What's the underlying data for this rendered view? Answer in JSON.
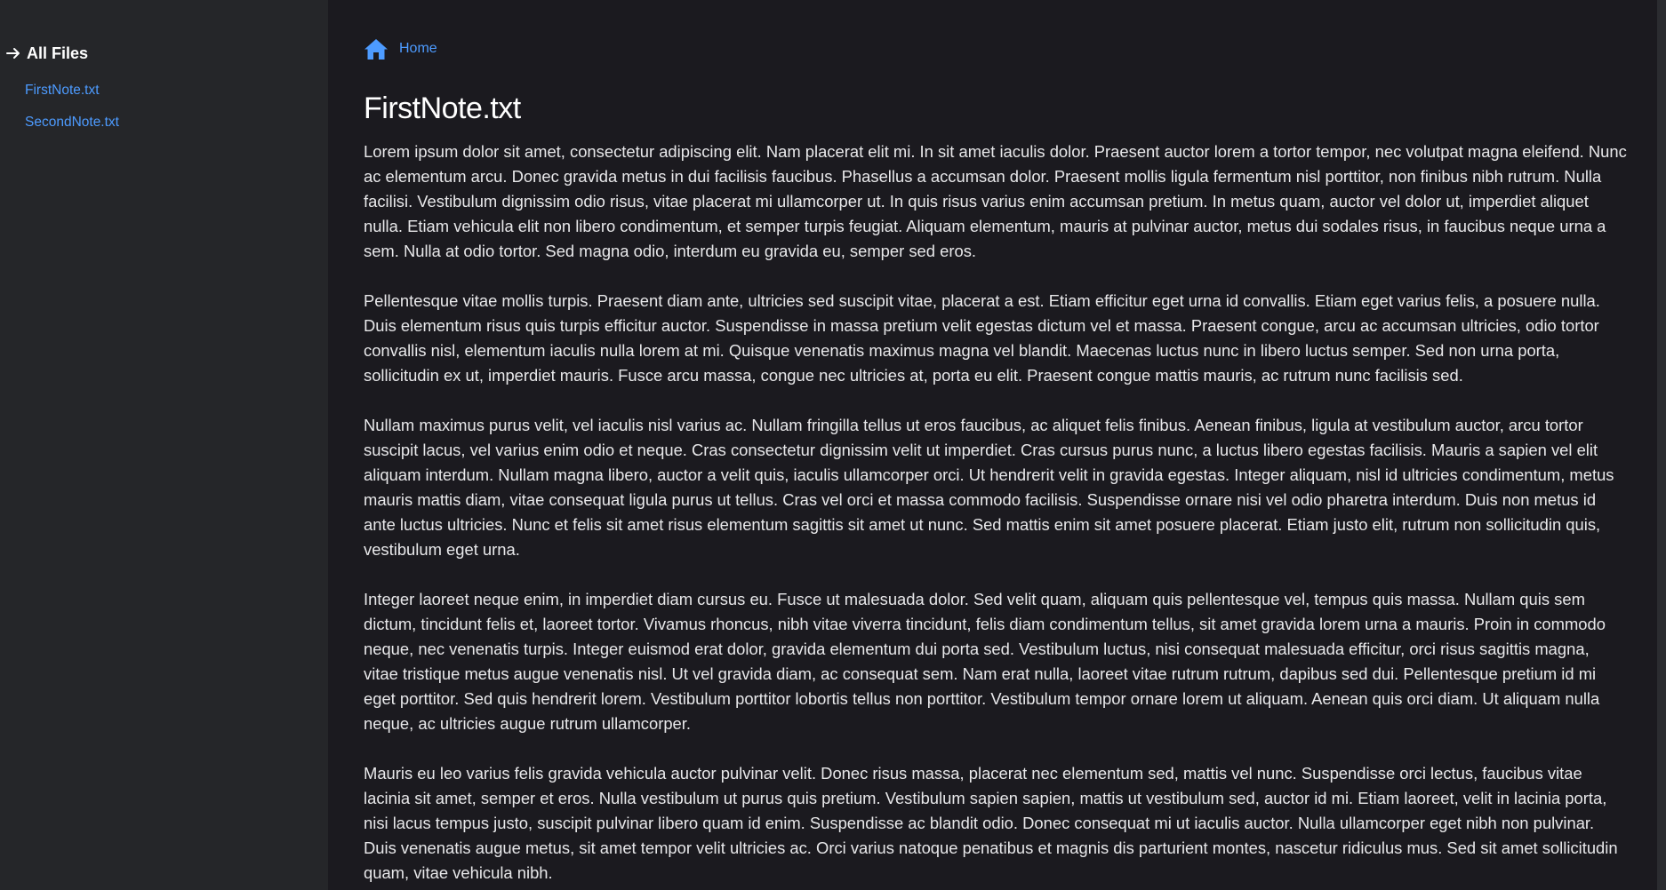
{
  "sidebar": {
    "header": "All Files",
    "files": [
      {
        "label": "FirstNote.txt"
      },
      {
        "label": "SecondNote.txt"
      }
    ]
  },
  "breadcrumb": {
    "home_label": "Home"
  },
  "note": {
    "title": "FirstNote.txt",
    "paragraphs": [
      "Lorem ipsum dolor sit amet, consectetur adipiscing elit. Nam placerat elit mi. In sit amet iaculis dolor. Praesent auctor lorem a tortor tempor, nec volutpat magna eleifend. Nunc ac elementum arcu. Donec gravida metus in dui facilisis faucibus. Phasellus a accumsan dolor. Praesent mollis ligula fermentum nisl porttitor, non finibus nibh rutrum. Nulla facilisi. Vestibulum dignissim odio risus, vitae placerat mi ullamcorper ut. In quis risus varius enim accumsan pretium. In metus quam, auctor vel dolor ut, imperdiet aliquet nulla. Etiam vehicula elit non libero condimentum, et semper turpis feugiat. Aliquam elementum, mauris at pulvinar auctor, metus dui sodales risus, in faucibus neque urna a sem. Nulla at odio tortor. Sed magna odio, interdum eu gravida eu, semper sed eros.",
      "Pellentesque vitae mollis turpis. Praesent diam ante, ultricies sed suscipit vitae, placerat a est. Etiam efficitur eget urna id convallis. Etiam eget varius felis, a posuere nulla. Duis elementum risus quis turpis efficitur auctor. Suspendisse in massa pretium velit egestas dictum vel et massa. Praesent congue, arcu ac accumsan ultricies, odio tortor convallis nisl, elementum iaculis nulla lorem at mi. Quisque venenatis maximus magna vel blandit. Maecenas luctus nunc in libero luctus semper. Sed non urna porta, sollicitudin ex ut, imperdiet mauris. Fusce arcu massa, congue nec ultricies at, porta eu elit. Praesent congue mattis mauris, ac rutrum nunc facilisis sed.",
      "Nullam maximus purus velit, vel iaculis nisl varius ac. Nullam fringilla tellus ut eros faucibus, ac aliquet felis finibus. Aenean finibus, ligula at vestibulum auctor, arcu tortor suscipit lacus, vel varius enim odio et neque. Cras consectetur dignissim velit ut imperdiet. Cras cursus purus nunc, a luctus libero egestas facilisis. Mauris a sapien vel elit aliquam interdum. Nullam magna libero, auctor a velit quis, iaculis ullamcorper orci. Ut hendrerit velit in gravida egestas. Integer aliquam, nisl id ultricies condimentum, metus mauris mattis diam, vitae consequat ligula purus ut tellus. Cras vel orci et massa commodo facilisis. Suspendisse ornare nisi vel odio pharetra interdum. Duis non metus id ante luctus ultricies. Nunc et felis sit amet risus elementum sagittis sit amet ut nunc. Sed mattis enim sit amet posuere placerat. Etiam justo elit, rutrum non sollicitudin quis, vestibulum eget urna.",
      "Integer laoreet neque enim, in imperdiet diam cursus eu. Fusce ut malesuada dolor. Sed velit quam, aliquam quis pellentesque vel, tempus quis massa. Nullam quis sem dictum, tincidunt felis et, laoreet tortor. Vivamus rhoncus, nibh vitae viverra tincidunt, felis diam condimentum tellus, sit amet gravida lorem urna a mauris. Proin in commodo neque, nec venenatis turpis. Integer euismod erat dolor, gravida elementum dui porta sed. Vestibulum luctus, nisi consequat malesuada efficitur, orci risus sagittis magna, vitae tristique metus augue venenatis nisl. Ut vel gravida diam, ac consequat sem. Nam erat nulla, laoreet vitae rutrum rutrum, dapibus sed dui. Pellentesque pretium id mi eget porttitor. Sed quis hendrerit lorem. Vestibulum porttitor lobortis tellus non porttitor. Vestibulum tempor ornare lorem ut aliquam. Aenean quis orci diam. Ut aliquam nulla neque, ac ultricies augue rutrum ullamcorper.",
      "Mauris eu leo varius felis gravida vehicula auctor pulvinar velit. Donec risus massa, placerat nec elementum sed, mattis vel nunc. Suspendisse orci lectus, faucibus vitae lacinia sit amet, semper et eros. Nulla vestibulum ut purus quis pretium. Vestibulum sapien sapien, mattis ut vestibulum sed, auctor id mi. Etiam laoreet, velit in lacinia porta, nisi lacus tempus justo, suscipit pulvinar libero quam id enim. Suspendisse ac blandit odio. Donec consequat mi ut iaculis auctor. Nulla ullamcorper eget nibh non pulvinar. Duis venenatis augue metus, sit amet tempor velit ultricies ac. Orci varius natoque penatibus et magnis dis parturient montes, nascetur ridiculus mus. Sed sit amet sollicitudin quam, vitae vehicula nibh."
    ]
  },
  "colors": {
    "link": "#4d9bff",
    "sidebar_bg": "#252629",
    "main_bg": "#1b1a1f",
    "text": "#e8e8ea"
  },
  "icons": {
    "sidebar_header": "arrow-right-icon",
    "breadcrumb": "home-icon"
  }
}
